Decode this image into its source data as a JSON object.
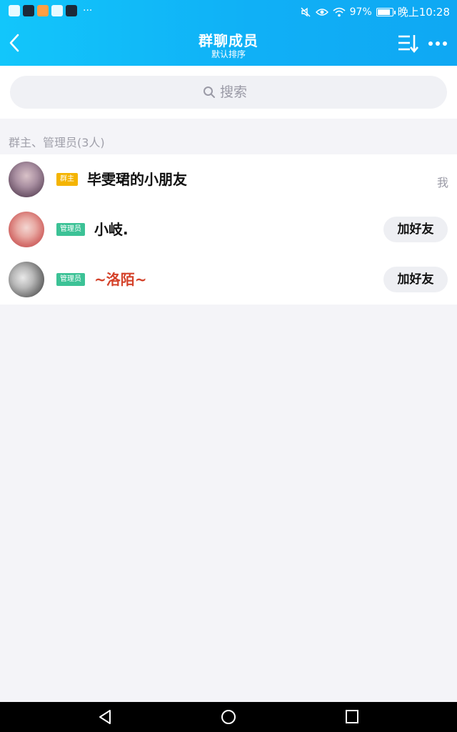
{
  "status_bar": {
    "more": "···",
    "battery": "97%",
    "battery_level": 0.97,
    "time": "晚上10:28",
    "icons": [
      "app-notification-icon",
      "app-notification-icon",
      "app-notification-icon",
      "app-notification-icon",
      "tiktok-icon",
      "mute-icon",
      "eye-icon",
      "wifi-icon",
      "battery-icon"
    ]
  },
  "header": {
    "title": "群聊成员",
    "subtitle": "默认排序",
    "icons": [
      "back-arrow-icon",
      "sort-icon",
      "more-dots-icon"
    ]
  },
  "search": {
    "placeholder": "搜索",
    "icon": "search-icon"
  },
  "section": {
    "label": "群主、管理员(3人)"
  },
  "members": [
    {
      "role": "群主",
      "name": "毕雯珺的小朋友",
      "action": "我"
    },
    {
      "role": "管理员",
      "name": "小岐.",
      "action": "加好友"
    },
    {
      "role": "管理员",
      "name": "~洛陌~",
      "action": "加好友"
    }
  ],
  "colors": {
    "header_gradient_start": "#12c6fb",
    "header_gradient_end": "#0fa8f3",
    "owner_badge": "#f4b400",
    "admin_badge": "#3cc296",
    "highlight_name": "#d4422a",
    "page_bg": "#f4f4f8"
  },
  "navbar": {
    "icons": [
      "back-triangle-icon",
      "home-circle-icon",
      "recents-square-icon"
    ]
  }
}
